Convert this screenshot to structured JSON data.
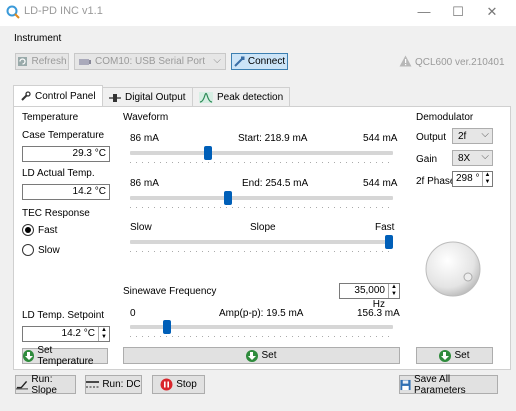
{
  "window": {
    "title": "LD-PD INC v1.1",
    "minimize": "—",
    "maximize": "☐",
    "close": "✕"
  },
  "instrument": {
    "label": "Instrument",
    "refresh_label": "Refresh",
    "port_value": "COM10: USB Serial Port",
    "connect_label": "Connect",
    "device_version": "QCL600 ver.210401"
  },
  "tabs": [
    {
      "label": "Control Panel",
      "icon": "wrench-icon"
    },
    {
      "label": "Digital Output",
      "icon": "plug-icon"
    },
    {
      "label": "Peak detection",
      "icon": "peak-icon"
    }
  ],
  "temperature": {
    "label": "Temperature",
    "case_temp_label": "Case Temperature",
    "case_temp_value": "29.3 °C",
    "ld_actual_label": "LD Actual Temp.",
    "ld_actual_value": "14.2 °C",
    "tec_label": "TEC Response",
    "fast_label": "Fast",
    "slow_label": "Slow",
    "tec_selected": "Fast",
    "setpoint_label": "LD Temp. Setpoint",
    "setpoint_value": "14.2 °C",
    "set_button": "Set Temperature"
  },
  "waveform": {
    "label": "Waveform",
    "start_min": "86 mA",
    "start_text": "Start:  218.9 mA",
    "start_max": "544 mA",
    "start_fraction": 0.29,
    "end_min": "86 mA",
    "end_text": "End:  254.5 mA",
    "end_max": "544 mA",
    "end_fraction": 0.37,
    "slope_min": "Slow",
    "slope_text": "Slope",
    "slope_max": "Fast",
    "slope_fraction": 1.0,
    "sine_label": "Sinewave Frequency",
    "sine_value": "35,000 Hz",
    "amp_min": "0",
    "amp_text": "Amp(p-p):  19.5 mA",
    "amp_max": "156.3 mA",
    "amp_fraction": 0.13,
    "set_button": "Set"
  },
  "demodulator": {
    "label": "Demodulator",
    "output_label": "Output",
    "output_value": "2f",
    "gain_label": "Gain",
    "gain_value": "8X",
    "phase_label": "2f Phase",
    "phase_value": "298 °",
    "set_button": "Set"
  },
  "bottom": {
    "run_slope": "Run: Slope",
    "run_dc": "Run: DC",
    "stop": "Stop",
    "save_all": "Save All Parameters"
  },
  "colors": {
    "accent": "#005fb8",
    "green": "#2e8b3c",
    "stop_red": "#d9262c",
    "panel_bg": "#f0f0f0"
  }
}
